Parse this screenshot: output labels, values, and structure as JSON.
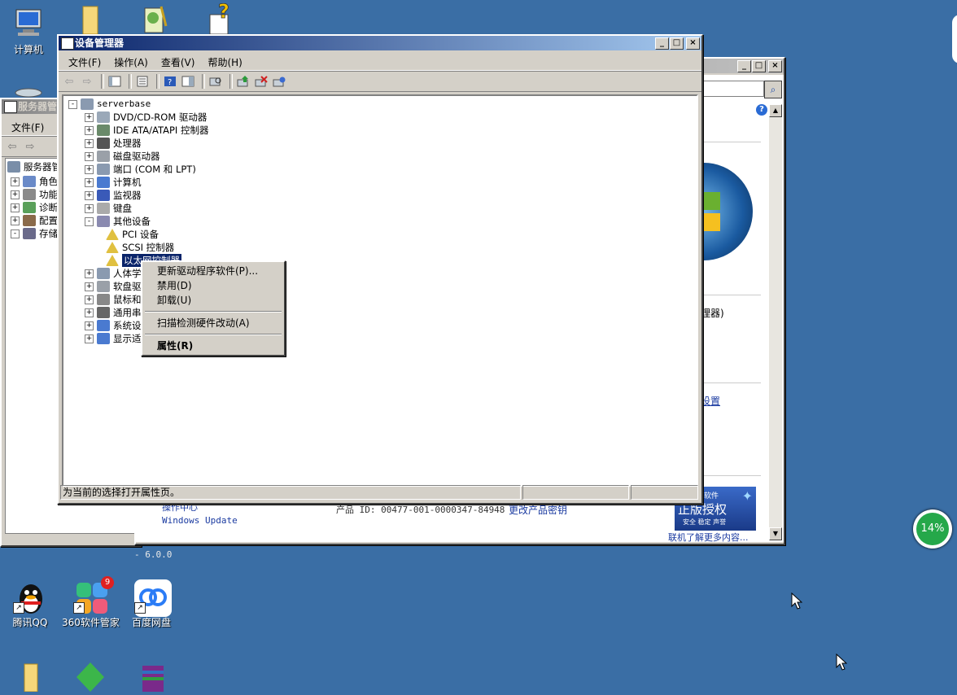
{
  "desktop": {
    "icons": [
      {
        "label": "计算机"
      },
      {
        "label": ""
      },
      {
        "label": ""
      },
      {
        "label": ""
      },
      {
        "label": "腾讯QQ"
      },
      {
        "label": "360软件管家"
      },
      {
        "label": "百度网盘"
      }
    ],
    "badge_count": "9",
    "cpu_widget": "14%"
  },
  "server_manager": {
    "title": "服务器管",
    "menu": {
      "file": "文件(F)"
    },
    "tree": [
      "服务器管",
      "角色",
      "功能",
      "诊断",
      "配置",
      "存储"
    ]
  },
  "system_window": {
    "right_texts": [
      "理器)",
      "设置"
    ],
    "windows_update": "Windows Update",
    "product_id": "产品 ID: 00477-001-0000347-84948",
    "change_key": "更改产品密钥",
    "truncated_link": "操作中心",
    "genuine": {
      "line1": "软件",
      "line2": "正版授权",
      "line3": "安全 稳定 声誉"
    },
    "learn_more": "联机了解更多内容...",
    "version": "- 6.0.0"
  },
  "device_manager": {
    "title": "设备管理器",
    "menu": [
      "文件(F)",
      "操作(A)",
      "查看(V)",
      "帮助(H)"
    ],
    "root": "serverbase",
    "nodes": [
      {
        "label": "DVD/CD-ROM 驱动器",
        "expander": "+"
      },
      {
        "label": "IDE ATA/ATAPI 控制器",
        "expander": "+"
      },
      {
        "label": "处理器",
        "expander": "+"
      },
      {
        "label": "磁盘驱动器",
        "expander": "+"
      },
      {
        "label": "端口 (COM 和 LPT)",
        "expander": "+"
      },
      {
        "label": "计算机",
        "expander": "+"
      },
      {
        "label": "监视器",
        "expander": "+"
      },
      {
        "label": "键盘",
        "expander": "+"
      },
      {
        "label": "其他设备",
        "expander": "-"
      },
      {
        "label": "PCI 设备",
        "expander": ""
      },
      {
        "label": "SCSI 控制器",
        "expander": ""
      },
      {
        "label": "以太网控制器",
        "expander": ""
      },
      {
        "label": "人体学",
        "expander": "+"
      },
      {
        "label": "软盘驱",
        "expander": "+"
      },
      {
        "label": "鼠标和",
        "expander": "+"
      },
      {
        "label": "通用串",
        "expander": "+"
      },
      {
        "label": "系统设",
        "expander": "+"
      },
      {
        "label": "显示适",
        "expander": "+"
      }
    ],
    "status": "为当前的选择打开属性页。"
  },
  "context_menu": {
    "items": [
      "更新驱动程序软件(P)...",
      "禁用(D)",
      "卸载(U)",
      "扫描检测硬件改动(A)",
      "属性(R)"
    ]
  },
  "colors": {
    "desktop": "#3a6ea5",
    "titlebar": "#0a246a",
    "selection": "#0a246a"
  }
}
